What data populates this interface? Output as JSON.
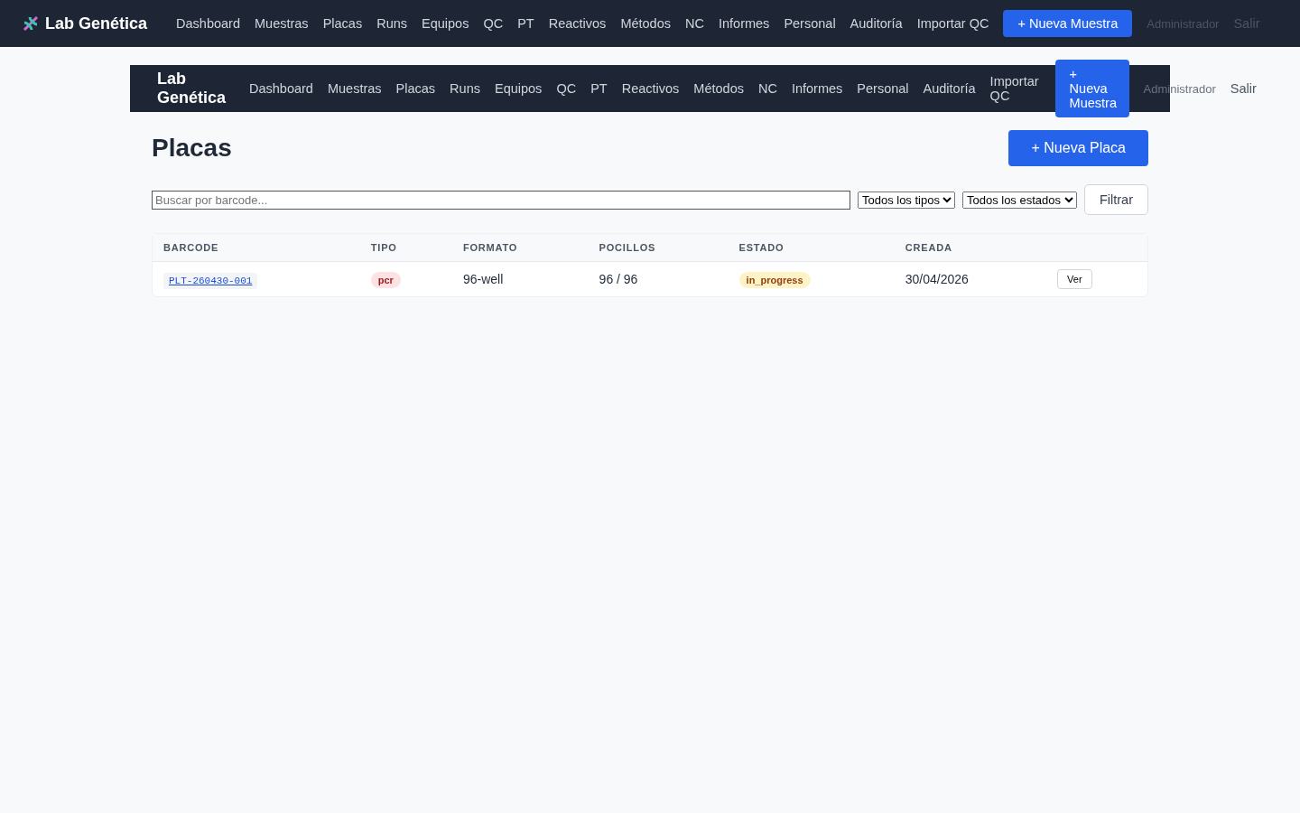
{
  "navbars": [
    {
      "brand": "Lab Genética",
      "links": [
        "Dashboard",
        "Muestras",
        "Placas",
        "Runs",
        "Equipos",
        "QC",
        "PT",
        "Reactivos",
        "Métodos",
        "NC",
        "Informes",
        "Personal",
        "Auditoría",
        "Importar QC"
      ],
      "new_button": "+ Nueva Muestra",
      "user": "Administrador",
      "logout": "Salir"
    },
    {
      "brand": "Lab Genética",
      "links": [
        "Dashboard",
        "Muestras",
        "Placas",
        "Runs",
        "Equipos",
        "QC",
        "PT",
        "Reactivos",
        "Métodos",
        "NC",
        "Informes",
        "Personal",
        "Auditoría",
        "Importar QC"
      ],
      "new_button": "+ Nueva Muestra",
      "user": "Administrador",
      "logout": "Salir"
    }
  ],
  "page": {
    "title": "Placas",
    "new_button": "+ Nueva Placa"
  },
  "filters": {
    "search": {
      "placeholder": "Buscar por barcode..."
    },
    "type_select": "Todos los tipos",
    "status_select": "Todos los estados",
    "filter_button": "Filtrar"
  },
  "table": {
    "columns": [
      "BARCODE",
      "TIPO",
      "FORMATO",
      "POCILLOS",
      "ESTADO",
      "CREADA"
    ],
    "rows": [
      {
        "barcode": "PLT-260430-001",
        "tipo": "pcr",
        "formato": "96-well",
        "pocillos": "96 / 96",
        "estado": "in_progress",
        "creada": "30/04/2026",
        "action": "Ver"
      }
    ]
  }
}
